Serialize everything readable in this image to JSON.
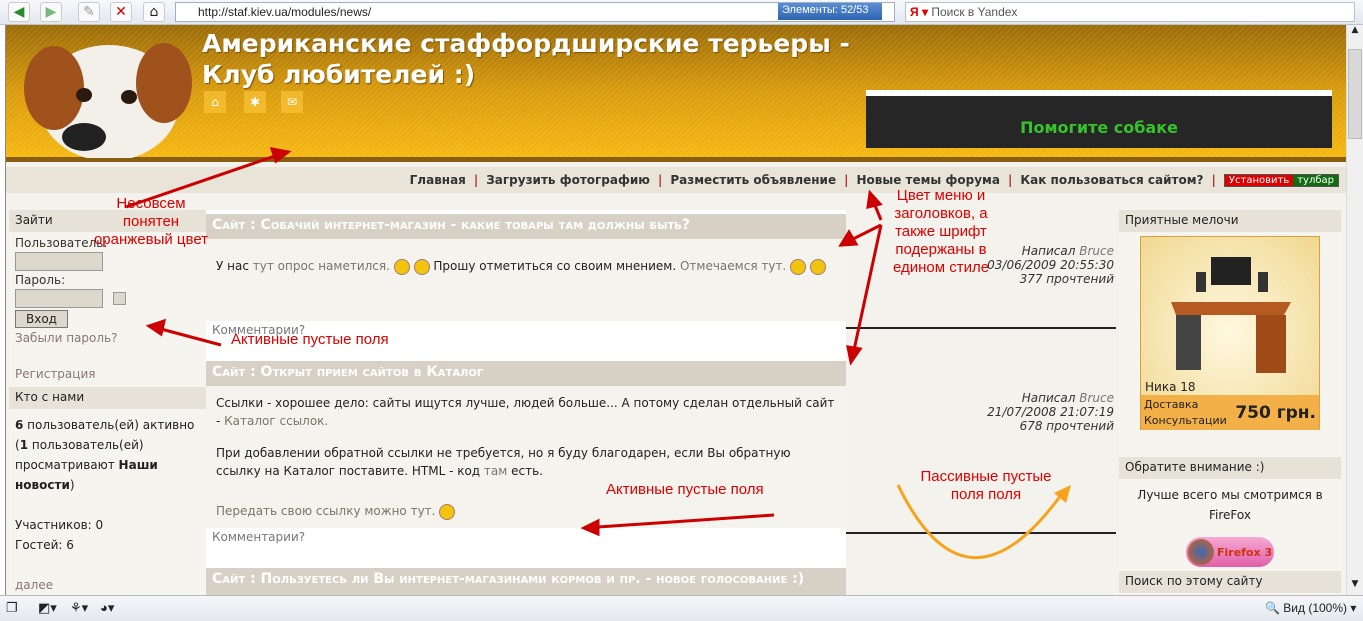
{
  "browser": {
    "url": "http://staf.kiev.ua/modules/news/",
    "elements_label": "Элементы:",
    "elements_count": "52/53",
    "search_placeholder": "Поиск в Yandex",
    "zoom": "Вид (100%)"
  },
  "header": {
    "title_line1": "Американские стаффордширские терьеры -",
    "title_line2": "Клуб любителей :)",
    "help_banner": "Помогите собаке"
  },
  "nav": {
    "items": [
      "Главная",
      "Загрузить фотографию",
      "Разместить объявление",
      "Новые темы форума",
      "Как пользоваться сайтом?"
    ],
    "install": "Установить",
    "toolbar": "тулбар"
  },
  "left": {
    "login_title": "Зайти",
    "user_label": "Пользователь:",
    "pass_label": "Пароль:",
    "login_button": "Вход",
    "forgot": "Забыли пароль?",
    "register": "Регистрация",
    "who_title": "Кто с нами",
    "who_count": "6",
    "who_t1": " пользователь(ей) активно (",
    "who_count2": "1",
    "who_t2": " пользователь(ей) просматривают ",
    "who_page": "Наши новости",
    "who_t3": ")",
    "members": "Участников: 0",
    "guests": "Гостей: 6",
    "more": "далее"
  },
  "articles": [
    {
      "title": "Сайт : Собачий интернет-магазин - какие товары там должны быть?",
      "p1a": "У нас ",
      "p1link": "тут опрос наметился.",
      "p1b": " Прошу отметиться со своим мнением. ",
      "p1link2": "Отмечаемся тут.",
      "comments": "Комментарии?",
      "meta_written": "Написал ",
      "author": "Bruce",
      "date": "03/06/2009 20:55:30",
      "reads": "377 прочтений"
    },
    {
      "title": "Сайт : Открыт прием сайтов в Каталог",
      "p1": "Ссылки - хорошее дело: сайты ищутся лучше, людей больше... А потому сделан отдельный сайт - ",
      "p1link": "Каталог ссылок.",
      "p2a": "При добавлении обратной ссылки не требуется, но я буду благодарен, если Вы обратную ссылку на Каталог поставите. HTML - код ",
      "p2link": "там",
      "p2b": " есть.",
      "p3": "Передать свою ссылку можно тут.",
      "comments": "Комментарии?",
      "meta_written": "Написал ",
      "author": "Bruce",
      "date": "21/07/2008 21:07:19",
      "reads": "678 прочтений"
    },
    {
      "title": "Сайт : Пользуетесь ли Вы интернет-магазинами кормов и пр. - новое голосование :)"
    }
  ],
  "right": {
    "block1_title": "Приятные мелочи",
    "product_name": "Ника 18",
    "delivery": "Доставка",
    "consult": "Консультации",
    "price": "750 грн.",
    "block2_title": "Обратите внимание :)",
    "block2_text": "Лучше всего мы смотримся в FireFox",
    "firefox": "Firefox 3",
    "block3_title": "Поиск по этому сайту"
  },
  "annotations": {
    "orange": "Несовсем понятен оранжевый цвет",
    "style": "Цвет меню и заголовков, а также шрифт подержаны в едином стиле",
    "active1": "Активные пустые поля",
    "active2": "Активные пустые поля",
    "passive": "Пассивные пустые поля поля"
  },
  "colors": {
    "header": "#e0a00c",
    "heading_bg": "#d6d1c4",
    "annotation": "#dd0000",
    "passive_arrow": "#f7a21a"
  }
}
